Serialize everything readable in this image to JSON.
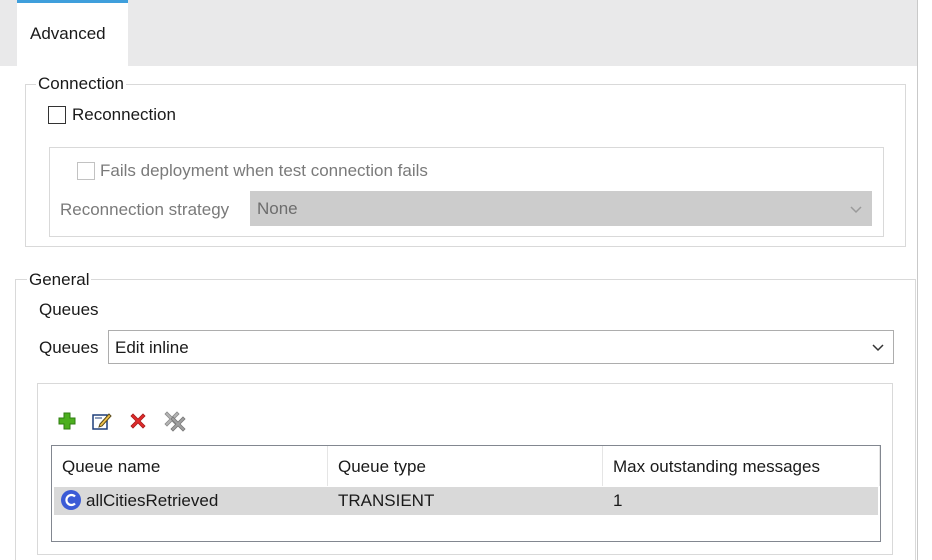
{
  "tabs": [
    {
      "label": "Advanced"
    }
  ],
  "connection": {
    "legend": "Connection",
    "reconnection_label": "Reconnection",
    "reconnection_checked": false,
    "fails_deployment_label": "Fails deployment when test connection fails",
    "strategy_label": "Reconnection strategy",
    "strategy_value": "None"
  },
  "general": {
    "legend": "General",
    "queues_heading": "Queues",
    "queues_label": "Queues",
    "queues_value": "Edit inline"
  },
  "toolbar": {
    "icons": [
      "add-icon",
      "edit-icon",
      "delete-icon",
      "delete-all-icon"
    ]
  },
  "table": {
    "columns": [
      "Queue name",
      "Queue type",
      "Max outstanding messages"
    ],
    "rows": [
      {
        "name": "allCitiesRetrieved",
        "type": "TRANSIENT",
        "max": "1",
        "icon": "queue-icon"
      }
    ]
  },
  "colors": {
    "tab_accent": "#3f9fdc",
    "selected_row": "#d9d9d9",
    "add_icon": "#4caf1f",
    "delete_icon": "#e02b2b",
    "queue_icon": "#3b5bd6"
  }
}
